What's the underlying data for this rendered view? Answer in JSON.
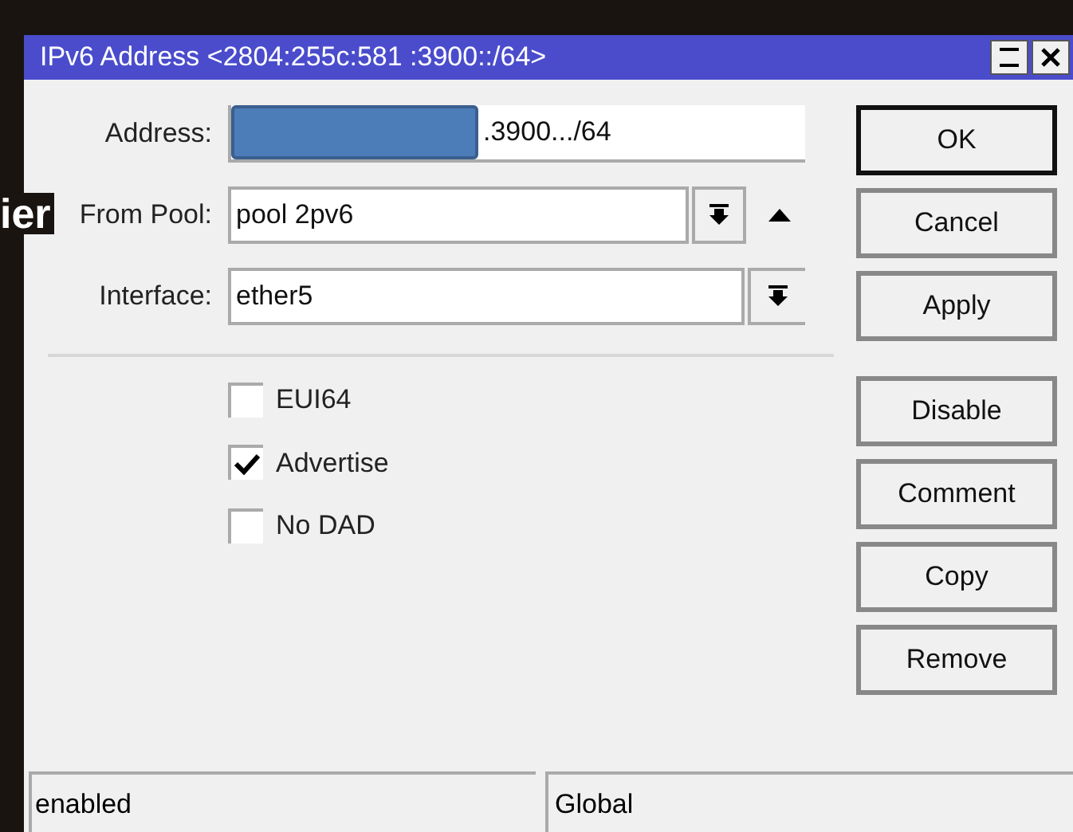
{
  "window": {
    "title": "IPv6 Address <2804:255c:581 :3900::/64>"
  },
  "overlay_text": "ier",
  "fields": [
    {
      "kind": "text",
      "label": "Address:",
      "value": ".3900.../64"
    },
    {
      "kind": "pool",
      "label": "From Pool:",
      "value": "pool 2pv6"
    },
    {
      "kind": "select",
      "label": "Interface:",
      "value": "ether5"
    }
  ],
  "checkboxes": [
    {
      "label": "EUI64",
      "checked": false
    },
    {
      "label": "Advertise",
      "checked": true
    },
    {
      "label": "No DAD",
      "checked": false
    }
  ],
  "buttons": [
    {
      "label": "OK",
      "default": true
    },
    {
      "label": "Cancel",
      "default": false
    },
    {
      "label": "Apply",
      "default": false
    },
    {
      "label": "Disable",
      "default": false
    },
    {
      "label": "Comment",
      "default": false
    },
    {
      "label": "Copy",
      "default": false
    },
    {
      "label": "Remove",
      "default": false
    }
  ],
  "status_bar": [
    "enabled",
    "Global"
  ]
}
